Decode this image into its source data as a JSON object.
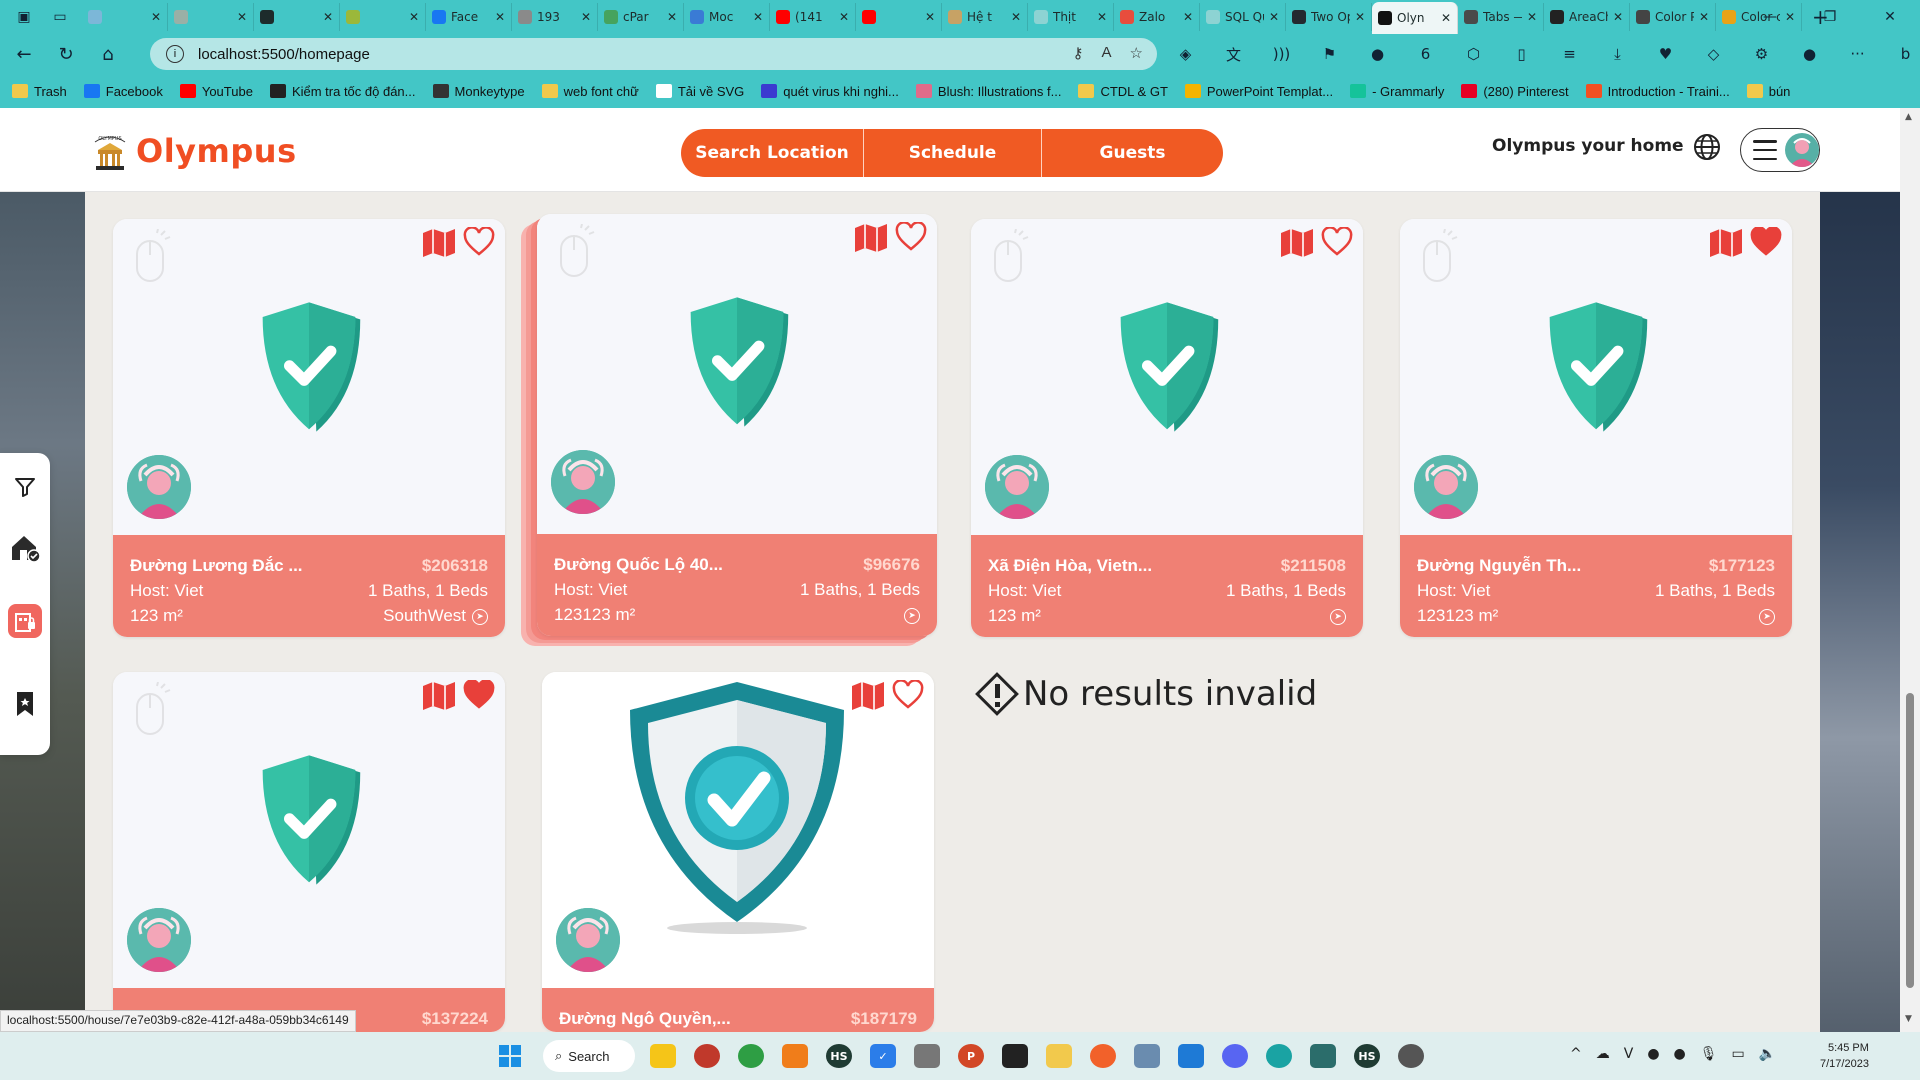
{
  "browser": {
    "tabs": [
      {
        "title": "",
        "color": "#7cb7d8"
      },
      {
        "title": "",
        "color": "#9ab0a6"
      },
      {
        "title": "",
        "color": "#1d2b2b"
      },
      {
        "title": "",
        "color": "#9bb83a"
      },
      {
        "title": "Face",
        "color": "#1877f2"
      },
      {
        "title": "193",
        "color": "#8a8a8a"
      },
      {
        "title": "cPar",
        "color": "#46a35e"
      },
      {
        "title": "Moc",
        "color": "#3a7bd5"
      },
      {
        "title": "(141",
        "color": "#ff0000"
      },
      {
        "title": "",
        "color": "#ff0000"
      },
      {
        "title": "Hệ t",
        "color": "#c7a265"
      },
      {
        "title": "Thịt",
        "color": "#8dd3d3"
      },
      {
        "title": "Zalo",
        "color": "#e84d3d"
      },
      {
        "title": "SQL Que",
        "color": "#8dd3d3"
      },
      {
        "title": "Two Op",
        "color": "#24292f"
      },
      {
        "title": "Olyn",
        "color": "#111111"
      },
      {
        "title": "Tabs — T",
        "color": "#4a4a4a"
      },
      {
        "title": "AreaCha",
        "color": "#222222"
      },
      {
        "title": "Color Pa",
        "color": "#444444"
      },
      {
        "title": "Color co",
        "color": "#e8a317"
      }
    ],
    "url": "localhost:5500/homepage",
    "bookmarks": [
      {
        "label": "Trash",
        "color": "#f2c94c"
      },
      {
        "label": "Facebook",
        "color": "#1877f2"
      },
      {
        "label": "YouTube",
        "color": "#ff0000"
      },
      {
        "label": "Kiểm tra tốc độ đán...",
        "color": "#222222"
      },
      {
        "label": "Monkeytype",
        "color": "#333333"
      },
      {
        "label": "web font chữ",
        "color": "#f2c94c"
      },
      {
        "label": "Tải về SVG",
        "color": "#ffffff"
      },
      {
        "label": "quét virus khi nghi...",
        "color": "#3b3bd0"
      },
      {
        "label": "Blush: Illustrations f...",
        "color": "#e06b8a"
      },
      {
        "label": "CTDL & GT",
        "color": "#f2c94c"
      },
      {
        "label": "PowerPoint Templat...",
        "color": "#f4b400"
      },
      {
        "label": "- Grammarly",
        "color": "#15c39a"
      },
      {
        "label": "(280) Pinterest",
        "color": "#e60023"
      },
      {
        "label": "Introduction - Traini...",
        "color": "#f25022"
      },
      {
        "label": "bún",
        "color": "#f2c94c"
      }
    ],
    "status_link": "localhost:5500/house/7e7e03b9-c82e-412f-a48a-059bb34c6149"
  },
  "site": {
    "logo_small": "OLYMPUS",
    "logo_text": "Olympus",
    "nav": [
      "Search Location",
      "Schedule",
      "Guests"
    ],
    "tagline": "Olympus your home",
    "brand_color": "#f05a23"
  },
  "cards": [
    {
      "address": "Đường Lương Đắc ...",
      "price": "$206318",
      "host": "Host: Viet",
      "specs": "1 Baths, 1 Beds",
      "area": "123 m²",
      "direction": "SouthWest",
      "favorite": false
    },
    {
      "address": "Đường Quốc Lộ 40...",
      "price": "$96676",
      "host": "Host: Viet",
      "specs": "1 Baths, 1 Beds",
      "area": "123123 m²",
      "direction": "",
      "favorite": false
    },
    {
      "address": "Xã Điện Hòa, Vietn...",
      "price": "$211508",
      "host": "Host: Viet",
      "specs": "1 Baths, 1 Beds",
      "area": "123 m²",
      "direction": "",
      "favorite": false
    },
    {
      "address": "Đường Nguyễn Th...",
      "price": "$177123",
      "host": "Host: Viet",
      "specs": "1 Baths, 1 Beds",
      "area": "123123 m²",
      "direction": "",
      "favorite": true
    },
    {
      "address": "",
      "price": "$137224",
      "host": "",
      "specs": "",
      "area": "",
      "direction": "",
      "favorite": true
    },
    {
      "address": "Đường Ngô Quyền,...",
      "price": "$187179",
      "host": "",
      "specs": "",
      "area": "",
      "direction": "",
      "favorite": false
    }
  ],
  "no_results": "No results invalid",
  "taskbar": {
    "search": "Search",
    "time": "5:45 PM",
    "date": "7/17/2023"
  }
}
